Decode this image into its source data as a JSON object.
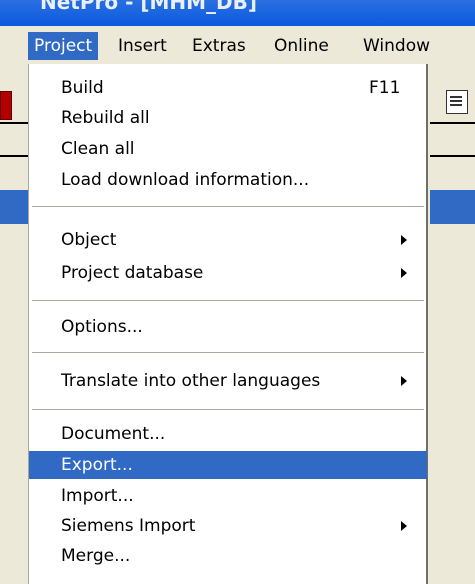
{
  "window": {
    "title": "NetPro - [MHM_DB]"
  },
  "menubar": {
    "items": [
      "Project",
      "Insert",
      "Extras",
      "Online",
      "Window"
    ],
    "active": "Project"
  },
  "project_menu": {
    "items": [
      {
        "label": "Build",
        "shortcut": "F11",
        "submenu": false
      },
      {
        "label": "Rebuild all",
        "shortcut": "",
        "submenu": false
      },
      {
        "label": "Clean all",
        "shortcut": "",
        "submenu": false
      },
      {
        "label": "Load download information...",
        "shortcut": "",
        "submenu": false
      },
      {
        "label": "Object",
        "shortcut": "",
        "submenu": true
      },
      {
        "label": "Project database",
        "shortcut": "",
        "submenu": true
      },
      {
        "label": "Options...",
        "shortcut": "",
        "submenu": false
      },
      {
        "label": "Translate into other languages",
        "shortcut": "",
        "submenu": true
      },
      {
        "label": "Document...",
        "shortcut": "",
        "submenu": false
      },
      {
        "label": "Export...",
        "shortcut": "",
        "submenu": false,
        "selected": true
      },
      {
        "label": "Import...",
        "shortcut": "",
        "submenu": false
      },
      {
        "label": "Siemens Import",
        "shortcut": "",
        "submenu": true
      },
      {
        "label": "Merge...",
        "shortcut": "",
        "submenu": false
      }
    ]
  },
  "colors": {
    "highlight": "#316ac5",
    "menubar_bg": "#ece9d8",
    "titlebar": "#0a5adf"
  }
}
